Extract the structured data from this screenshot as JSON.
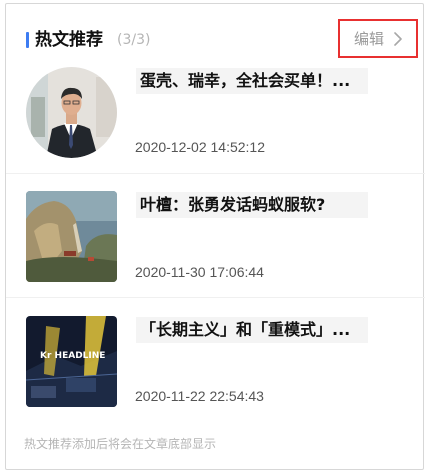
{
  "header": {
    "title": "热文推荐",
    "count": "(3/3)",
    "edit_label": "编辑"
  },
  "articles": [
    {
      "title": "蛋壳、瑞幸，全社会买单！...",
      "time": "2020-12-02 14:52:12",
      "thumb": "portrait-photo"
    },
    {
      "title": "叶檀：张勇发话蚂蚁服软?",
      "time": "2020-11-30 17:06:44",
      "thumb": "landscape-painting"
    },
    {
      "title": "「长期主义」和「重模式」...",
      "time": "2020-11-22 22:54:43",
      "thumb": "kr-headline-cover",
      "thumb_text": "Kr HEADLINE"
    }
  ],
  "footer": {
    "note": "热文推荐添加后将会在文章底部显示"
  },
  "colors": {
    "accent": "#3d7cf2",
    "highlight_border": "#e83030",
    "muted_text": "#b5b5b5"
  }
}
